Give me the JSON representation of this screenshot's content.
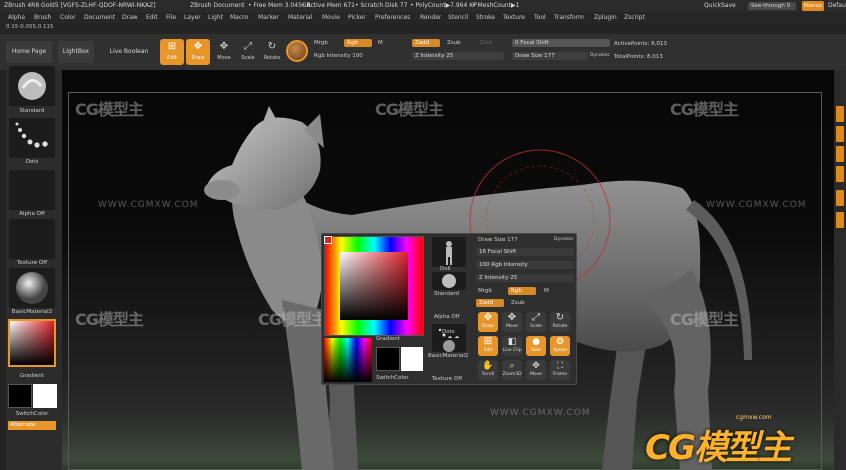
{
  "titlebar": {
    "app_title": "ZBrush 4R8 Gold5 [VGFS-ZLHF-QDOF-NRWI-NKAZ]",
    "doc": "ZBrush Document",
    "free_mem": "• Free Mem 3.045GB",
    "active_mem": "• Active Mem 671",
    "scratch": "• Scratch Disk 77",
    "polycount": "• PolyCount▶7.964 KP",
    "meshcount": "• MeshCount▶1",
    "quicksave": "QuickSave",
    "see_through": "See-through  0",
    "menus": "Menus",
    "default": "Default"
  },
  "menu": [
    "Alpha",
    "Brush",
    "Color",
    "Document",
    "Draw",
    "Edit",
    "File",
    "Layer",
    "Light",
    "Macro",
    "Marker",
    "Material",
    "Movie",
    "Picker",
    "Preferences",
    "Render",
    "Stencil",
    "Stroke",
    "Texture",
    "Tool",
    "Transform",
    "Zplugin",
    "Zscript"
  ],
  "coords": "0.15-0.055,0.115",
  "shelf": {
    "home": "Home Page",
    "lightbox": "LightBox",
    "live_boolean": "Live Boolean",
    "edit": "Edit",
    "draw": "Draw",
    "move": "Move",
    "scale": "Scale",
    "rotate": "Rotate",
    "mrgb": "Mrgb",
    "rgb": "Rgb",
    "m": "M",
    "rgb_intensity": "Rgb Intensity 100",
    "zadd": "Zadd",
    "zsub": "Zsub",
    "zcut": "Zcut",
    "z_intensity": "Z Intensity 25",
    "focal_shift": "0 Focal Shift",
    "draw_size": "Draw Size 177",
    "dynamic": "Dynamic",
    "active_points": "ActivePoints: 8,013",
    "total_points": "TotalPoints: 8,013"
  },
  "left_tray": {
    "standard": "Standard",
    "dots": "Dots",
    "alpha_off": "Alpha Off",
    "texture_off": "Texture Off",
    "material": "BasicMaterial2",
    "gradient": "Gradient",
    "switch_color": "SwitchColor",
    "alternate": "Alternate"
  },
  "popup": {
    "draw_size": "Draw Size 177",
    "dynamic": "Dynamic",
    "focal_shift": "16 Focal Shift",
    "rgb_intensity": "100 Rgb Intensity",
    "z_intensity": "Z Intensity 25",
    "mrgb": "Mrgb",
    "rgb": "Rgb",
    "m": "M",
    "zadd": "Zadd",
    "zsub": "Zsub",
    "doll": "Doll",
    "standard": "Standard",
    "alpha_off": "Alpha Off",
    "dots": "Dots",
    "material": "BasicMaterial2",
    "texture_off": "Texture Off",
    "gradient": "Gradient",
    "switch_color": "SwitchColor",
    "btn_draw": "Draw",
    "btn_move": "Move",
    "btn_scale": "Scale",
    "btn_rotate": "Rotate",
    "btn_edit": "Edit",
    "btn_liveclip": "Live Clip",
    "btn_solo": "Solo",
    "btn_xpose": "Xpose",
    "btn_scroll": "Scroll",
    "btn_zoom": "Zoom3D",
    "btn_move2": "Move",
    "btn_frame": "Frame"
  },
  "watermark": {
    "brand": "CG模型主",
    "url": "WWW.CGMXW.COM",
    "url_small": "cgmxw.com"
  },
  "colors": {
    "accent": "#e8962a",
    "canvas": "#0a0a0a"
  }
}
